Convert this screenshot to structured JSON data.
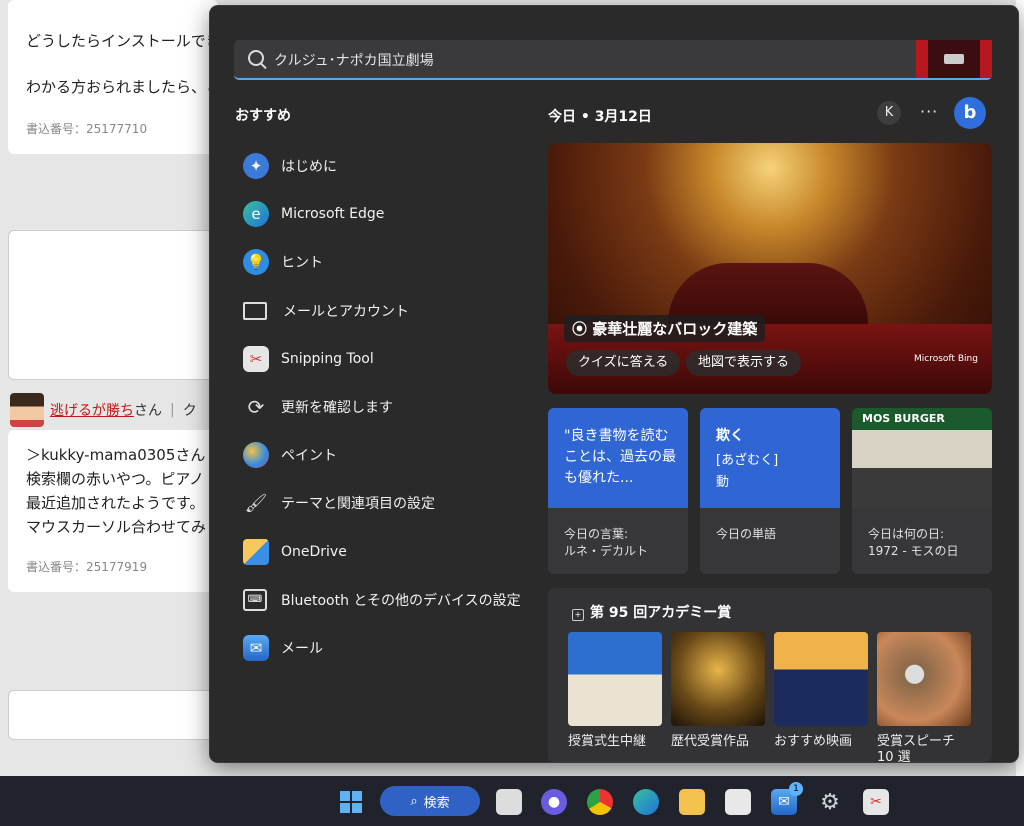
{
  "background": {
    "post1_line1": "どうしたらインストールできる",
    "post1_line2": "わかる方おられましたら、こ",
    "post1_meta": "書込番号：25177710",
    "user_name": "逃げるが勝ち",
    "user_suffix": "さん",
    "user_extra": "ク",
    "post2_lines": [
      "＞kukky-mama0305さん",
      "検索欄の赤いやつ。ピアノ",
      "最近追加されたようです。",
      "マウスカーソル合わせてみ"
    ],
    "post2_meta": "書込番号：25177919"
  },
  "search": {
    "value": "クルジュ･ナポカ国立劇場"
  },
  "left": {
    "title": "おすすめ",
    "apps": [
      {
        "label": "はじめに",
        "icon": "getstarted-icon"
      },
      {
        "label": "Microsoft Edge",
        "icon": "edge-icon"
      },
      {
        "label": "ヒント",
        "icon": "tips-icon"
      },
      {
        "label": "メールとアカウント",
        "icon": "mail-account-icon"
      },
      {
        "label": "Snipping Tool",
        "icon": "snipping-tool-icon"
      },
      {
        "label": "更新を確認します",
        "icon": "update-icon"
      },
      {
        "label": "ペイント",
        "icon": "paint-icon"
      },
      {
        "label": "テーマと関連項目の設定",
        "icon": "theme-brush-icon"
      },
      {
        "label": "OneDrive",
        "icon": "onedrive-icon"
      },
      {
        "label": "Bluetooth とその他のデバイスの設定",
        "icon": "bluetooth-devices-icon"
      },
      {
        "label": "メール",
        "icon": "mail-icon"
      }
    ]
  },
  "right": {
    "date": "今日 • 3月12日",
    "avatar_letter": "K",
    "more": "···",
    "bing_letter": "b",
    "hero": {
      "tag": "豪華壮麗なバロック建築",
      "quiz_button": "クイズに答える",
      "map_button": "地図で表示する",
      "logo_text": "Microsoft Bing"
    },
    "cards": [
      {
        "top": "\"良き書物を読むことは、過去の最も優れた...",
        "bottom1": "今日の言葉:",
        "bottom2": "ルネ・デカルト"
      },
      {
        "top_word": "欺く",
        "top_reading": "[あざむく]",
        "top_pos": "動",
        "bottom1": "今日の単語",
        "bottom2": ""
      },
      {
        "top_sign": "MOS BURGER",
        "bottom1": "今日は何の日:",
        "bottom2": "1972 - モスの日"
      }
    ],
    "oscars": {
      "title": "第 95 回アカデミー賞",
      "items": [
        "授賞式生中継",
        "歴代受賞作品",
        "おすすめ映画",
        "受賞スピーチ 10 選"
      ]
    }
  },
  "taskbar": {
    "search_label": "検索",
    "mail_badge": "1"
  }
}
